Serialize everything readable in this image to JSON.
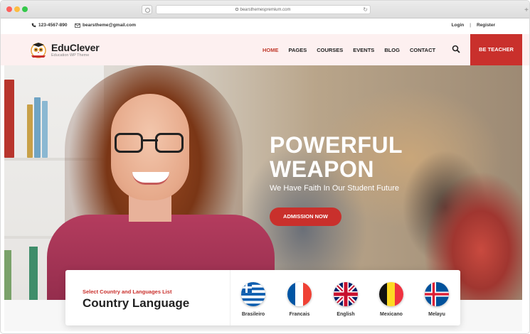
{
  "browser": {
    "url": "bearsthemespremium.com"
  },
  "topbar": {
    "phone": "123-4567-890",
    "email": "bearstheme@gmail.com",
    "login": "Login",
    "separator": "|",
    "register": "Register"
  },
  "header": {
    "logo_name": "EduClever",
    "logo_tagline": "Education WP Theme",
    "nav": [
      "HOME",
      "PAGES",
      "COURSES",
      "EVENTS",
      "BLOG",
      "CONTACT"
    ],
    "active_nav": "HOME",
    "cta": "BE TEACHER"
  },
  "hero": {
    "title_line1": "POWERFUL",
    "title_line2": "WEAPON",
    "subtitle": "We Have Faith In Our Student Future",
    "button": "ADMISSION NOW"
  },
  "languages": {
    "label": "Select Country and Languages List",
    "title": "Country Language",
    "items": [
      {
        "label": "Brasileiro",
        "icon": "greece-flag-icon"
      },
      {
        "label": "Francais",
        "icon": "france-flag-icon"
      },
      {
        "label": "English",
        "icon": "uk-flag-icon"
      },
      {
        "label": "Mexicano",
        "icon": "belgium-flag-icon"
      },
      {
        "label": "Melayu",
        "icon": "iceland-flag-icon"
      }
    ]
  },
  "colors": {
    "accent": "#c9302c",
    "header_bg": "#fdf0f0"
  }
}
